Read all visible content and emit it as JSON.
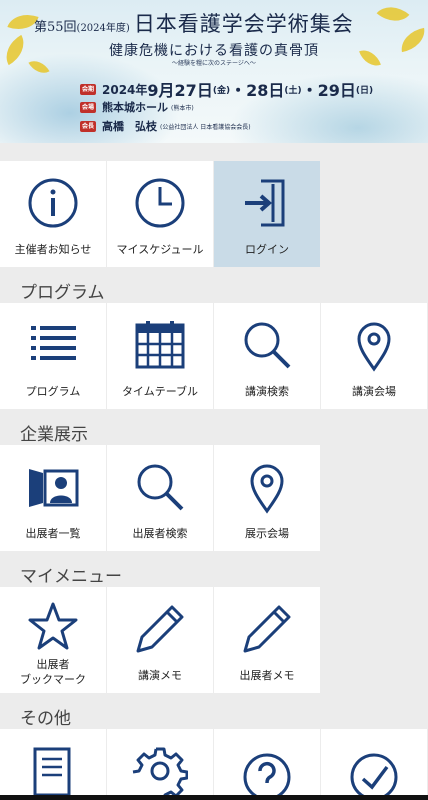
{
  "banner": {
    "edition": "第55回",
    "edition_year": "(2024年度)",
    "title": "日本看護学会学術集会",
    "theme": "健康危機における看護の真骨頂",
    "subtheme": "〜経験を糧に次のステージへ〜",
    "date_tag": "会期",
    "date_year": "2024年",
    "date_m": "9月",
    "date_d1": "27日",
    "date_w1": "(金)",
    "date_d2": "・28日",
    "date_w2": "(土)",
    "date_d3": "・29日",
    "date_w3": "(日)",
    "venue_tag": "会場",
    "venue": "熊本城ホール",
    "venue_city": "(熊本市)",
    "chair_tag": "会長",
    "chair": "高橋　弘枝",
    "chair_org": "(公益社団法人 日本看護協会会長)"
  },
  "top_tiles": [
    {
      "label": "主催者お知らせ",
      "icon": "info-icon"
    },
    {
      "label": "マイスケジュール",
      "icon": "clock-icon"
    },
    {
      "label": "ログイン",
      "icon": "login-icon"
    }
  ],
  "sections": {
    "program": "プログラム",
    "exhibit": "企業展示",
    "mymenu": "マイメニュー",
    "other": "その他"
  },
  "program_tiles": [
    {
      "label": "プログラム",
      "icon": "list-icon"
    },
    {
      "label": "タイムテーブル",
      "icon": "calendar-icon"
    },
    {
      "label": "講演検索",
      "icon": "search-icon"
    },
    {
      "label": "講演会場",
      "icon": "map-pin-icon"
    }
  ],
  "exhibit_tiles": [
    {
      "label": "出展者一覧",
      "icon": "exhibitor-icon"
    },
    {
      "label": "出展者検索",
      "icon": "search-icon"
    },
    {
      "label": "展示会場",
      "icon": "map-pin-icon"
    }
  ],
  "mymenu_tiles": [
    {
      "label_line1": "出展者",
      "label_line2": "ブックマーク",
      "icon": "star-icon"
    },
    {
      "label": "講演メモ",
      "icon": "pencil-icon"
    },
    {
      "label": "出展者メモ",
      "icon": "pencil-icon"
    }
  ],
  "other_tiles": [
    {
      "icon": "document-icon"
    },
    {
      "icon": "gear-icon"
    },
    {
      "icon": "help-icon"
    },
    {
      "icon": "check-icon"
    }
  ],
  "colors": {
    "icon": "#1b3f7a",
    "active_tile": "#c9dbe7",
    "background": "#ececec"
  }
}
